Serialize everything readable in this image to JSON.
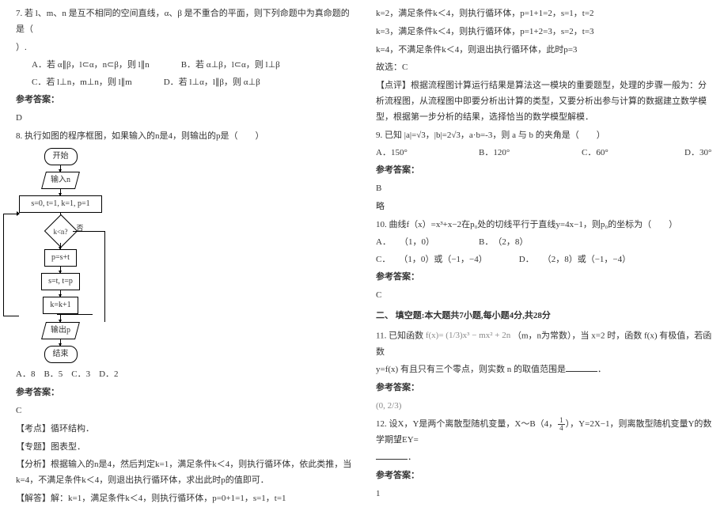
{
  "left": {
    "q7": {
      "stem1": "7. 若 l、m、n 是互不相同的空间直线，α、β 是不重合的平面，则下列命题中为真命题的是（",
      "stem2": "）.",
      "optA": "A．若 α∥β，l⊂α，n⊂β，则 l∥n",
      "optB": "B．若 α⊥β，l⊂α，则 l⊥β",
      "optC": "C．若 l⊥n，m⊥n，则 l∥m",
      "optD": "D．若 l⊥α，l∥β，则 α⊥β",
      "ansLabel": "参考答案：",
      "ans": "D"
    },
    "q8": {
      "stem": "8. 执行如图的程序框图，如果输入的n是4，则输出的p是（　　）",
      "flow": {
        "start": "开始",
        "input": "输入n",
        "init": "s=0, t=1, k=1, p=1",
        "cond": "k<n?",
        "no": "否",
        "step1": "p=s+t",
        "step2": "s=t, t=p",
        "step3": "k=k+1",
        "output": "输出p",
        "end": "结束"
      },
      "opts": "A．8　B．5　C．3　D．2",
      "ansLabel": "参考答案：",
      "ans": "C",
      "e1": "【考点】循环结构．",
      "e2": "【专题】图表型．",
      "e3": "【分析】根据输入的n是4，然后判定k=1，满足条件k＜4，则执行循环体，依此类推，当k=4，不满足条件k＜4，则退出执行循环体，求出此时p的值即可．",
      "e4": "【解答】解：k=1，满足条件k＜4，则执行循环体，p=0+1=1，s=1，t=1"
    }
  },
  "right": {
    "cont": {
      "l1": "k=2，满足条件k＜4，则执行循环体，p=1+1=2，s=1，t=2",
      "l2": "k=3，满足条件k＜4，则执行循环体，p=1+2=3，s=2，t=3",
      "l3": "k=4，不满足条件k＜4，则退出执行循环体，此时p=3",
      "l4": "故选：C",
      "l5": "【点评】根据流程图计算运行结果是算法这一模块的重要题型，处理的步骤一般为：分析流程图，从流程图中即要分析出计算的类型，又要分析出参与计算的数据建立数学模型，根据第一步分析的结果，选择恰当的数学模型解模．"
    },
    "q9": {
      "stem": "9. 已知 |a|=√3，|b|=2√3，a·b=-3，则 a 与 b 的夹角是（　　）",
      "optA": "A．150°",
      "optB": "B．120°",
      "optC": "C．60°",
      "optD": "D．30°",
      "ansLabel": "参考答案：",
      "ans": "B",
      "note": "略"
    },
    "q10": {
      "stem": "10. 曲线f（x）=x³+x−2在p₀处的切线平行于直线y=4x−1，则p₀的坐标为（　　）",
      "a": "A．　　（1，0）",
      "b": "B．　（2，8）",
      "c": "C．　　（1，0）或（−1，−4）",
      "d": "D．　　（2，8）或（−1，−4）",
      "ansLabel": "参考答案：",
      "ans": "C"
    },
    "sectionTitle": "二、 填空题:本大题共7小题,每小题4分,共28分",
    "q11": {
      "stem_a": "11. 已知函数 ",
      "formula": "f(x)= (1/3)x³ − mx² + 2n",
      "stem_b": "（m，n为常数），当 x=2 时，函数 f(x) 有极值，若函数",
      "stem_c": "y=f(x) 有且只有三个零点，则实数 n 的取值范围是",
      "stem_d": "．",
      "ansLabel": "参考答案：",
      "ans": "(0, 2/3)"
    },
    "q12": {
      "stem_a": "12. 设X，Y是两个离散型随机变量，X～B（4，",
      "frac_num": "1",
      "frac_den": "4",
      "stem_b": "），Y=2X−1，则离散型随机变量Y的数学期望EY=",
      "stem_c": "．",
      "ansLabel": "参考答案：",
      "ans": "1"
    }
  }
}
